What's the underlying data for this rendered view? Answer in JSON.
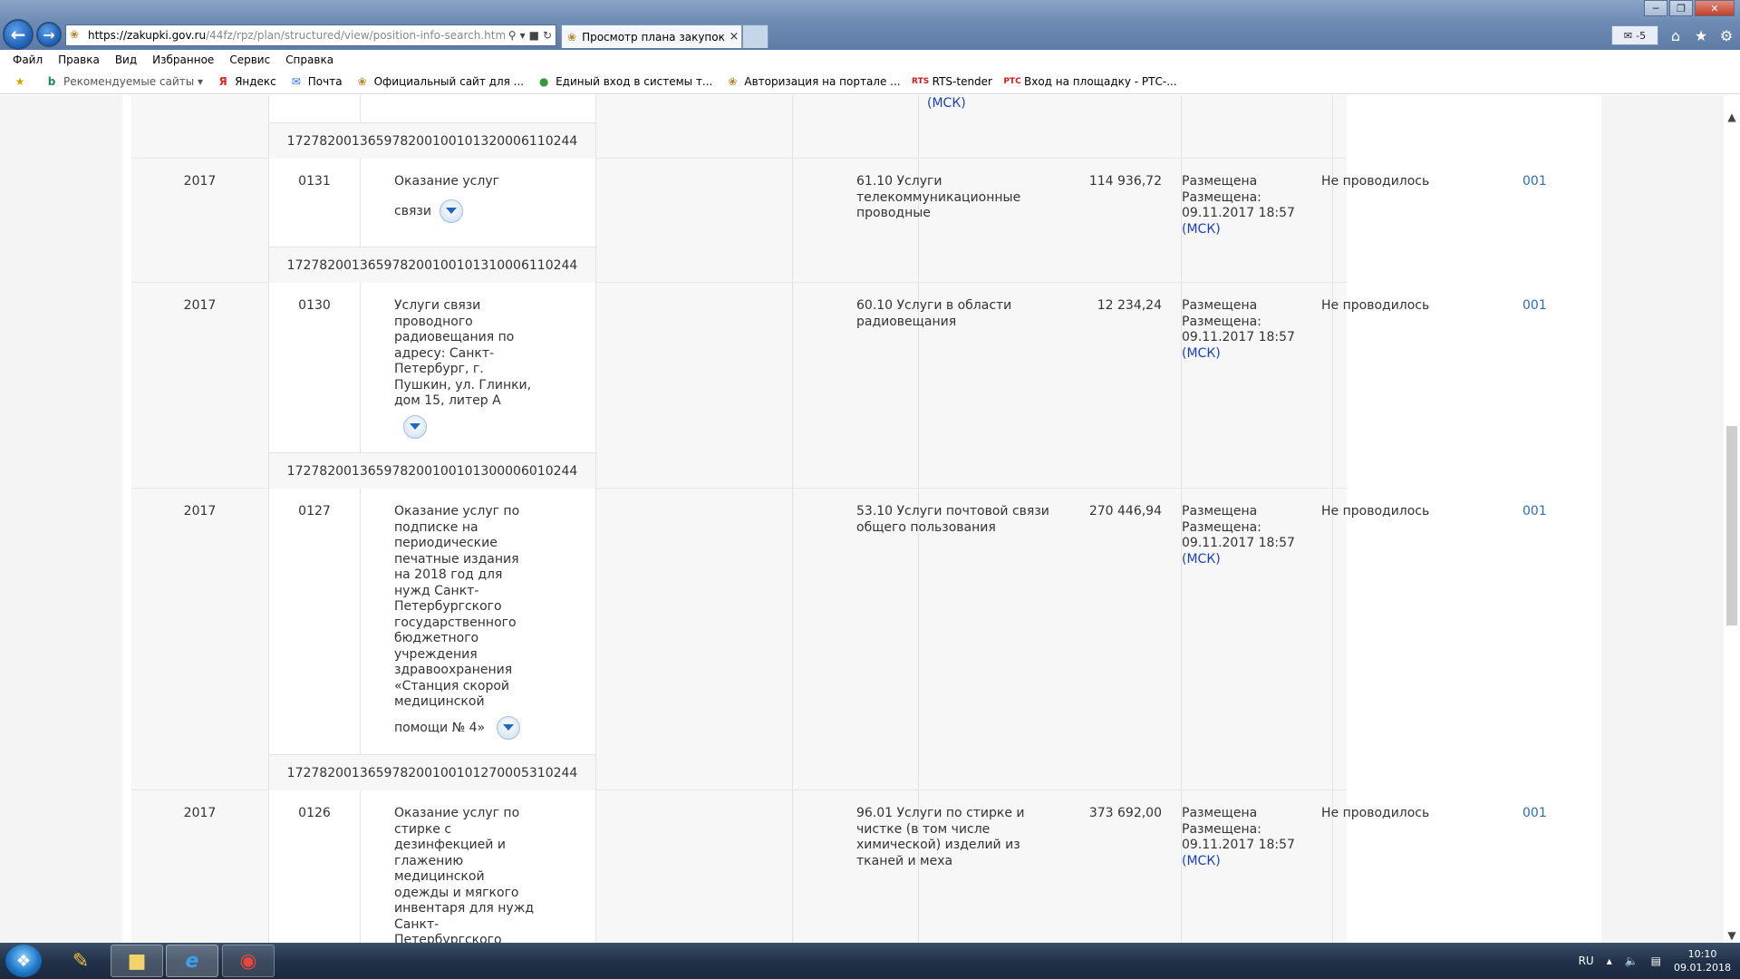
{
  "browser": {
    "url_host": "https://zakupki.gov.ru",
    "url_path": "/44fz/rpz/plan/structured/view/position-info-search.html?statu",
    "tab_title": "Просмотр плана закупок",
    "tab_close": "×",
    "feeds_count": "-5"
  },
  "menu": [
    "Файл",
    "Правка",
    "Вид",
    "Избранное",
    "Сервис",
    "Справка"
  ],
  "favorites": [
    {
      "label": "Рекомендуемые сайты ▾",
      "icon": "bing-icon"
    },
    {
      "label": "Яндекс",
      "icon": "yandex-icon"
    },
    {
      "label": "Почта",
      "icon": "mail-icon"
    },
    {
      "label": "Официальный сайт для ...",
      "icon": "emblem-icon"
    },
    {
      "label": "Единый вход в системы т...",
      "icon": "globe-icon"
    },
    {
      "label": "Авторизация на портале ...",
      "icon": "emblem-icon"
    },
    {
      "label": "RTS-tender",
      "icon": "rts-icon"
    },
    {
      "label": "Вход на площадку - РТС-...",
      "icon": "rtc-icon"
    }
  ],
  "table": {
    "top_partial": {
      "status_tail": "(МСК)",
      "code": "172782001365978200100101320006110244"
    },
    "rows": [
      {
        "year": "2017",
        "number": "0131",
        "name_lines": [
          "Оказание услуг"
        ],
        "name_last": "связи",
        "okpd": [
          "61.10 Услуги",
          "телекоммуникационные",
          "проводные"
        ],
        "amount": "114 936,72",
        "status_lines": [
          "Размещена",
          "Размещена:",
          "09.11.2017 18:57"
        ],
        "status_tz": "(МСК)",
        "procedure": "Не проводилось",
        "lot": "001",
        "code": "172782001365978200100101310006110244"
      },
      {
        "year": "2017",
        "number": "0130",
        "name_lines": [
          "Услуги связи",
          "проводного",
          "радиовещания по",
          "адресу: Санкт-",
          "Петербург, г.",
          "Пушкин, ул. Глинки,",
          "дом 15, литер А"
        ],
        "name_last": "",
        "okpd": [
          "60.10 Услуги в области",
          "радиовещания"
        ],
        "amount": "12 234,24",
        "status_lines": [
          "Размещена",
          "Размещена:",
          "09.11.2017 18:57"
        ],
        "status_tz": "(МСК)",
        "procedure": "Не проводилось",
        "lot": "001",
        "code": "172782001365978200100101300006010244"
      },
      {
        "year": "2017",
        "number": "0127",
        "name_lines": [
          "Оказание услуг по",
          "подписке на",
          "периодические",
          "печатные издания",
          "на 2018 год для",
          "нужд Санкт-",
          "Петербургского",
          "государственного",
          "бюджетного",
          "учреждения",
          "здравоохранения",
          "«Станция скорой",
          "медицинской"
        ],
        "name_last": "помощи № 4»",
        "okpd": [
          "53.10 Услуги почтовой связи",
          "общего пользования"
        ],
        "amount": "270 446,94",
        "status_lines": [
          "Размещена",
          "Размещена:",
          "09.11.2017 18:57"
        ],
        "status_tz": "(МСК)",
        "procedure": "Не проводилось",
        "lot": "001",
        "code": "172782001365978200100101270005310244"
      },
      {
        "year": "2017",
        "number": "0126",
        "name_lines": [
          "Оказание услуг по",
          "стирке с",
          "дезинфекцией и",
          "глажению",
          "медицинской",
          "одежды и мягкого",
          "инвентаря для нужд",
          "Санкт-",
          "Петербургского"
        ],
        "name_last": "",
        "okpd": [
          "96.01 Услуги по стирке и",
          "чистке (в том числе",
          "химической) изделий из",
          "тканей и меха"
        ],
        "amount": "373 692,00",
        "status_lines": [
          "Размещена",
          "Размещена:",
          "09.11.2017 18:57"
        ],
        "status_tz": "(МСК)",
        "procedure": "Не проводилось",
        "lot": "001",
        "code": ""
      }
    ]
  },
  "taskbar": {
    "lang": "RU",
    "time": "10:10",
    "date": "09.01.2018"
  },
  "colors": {
    "link": "#1a3fc5",
    "lot_link": "#2a6fb5",
    "row_bg": "#f7f7f7"
  }
}
